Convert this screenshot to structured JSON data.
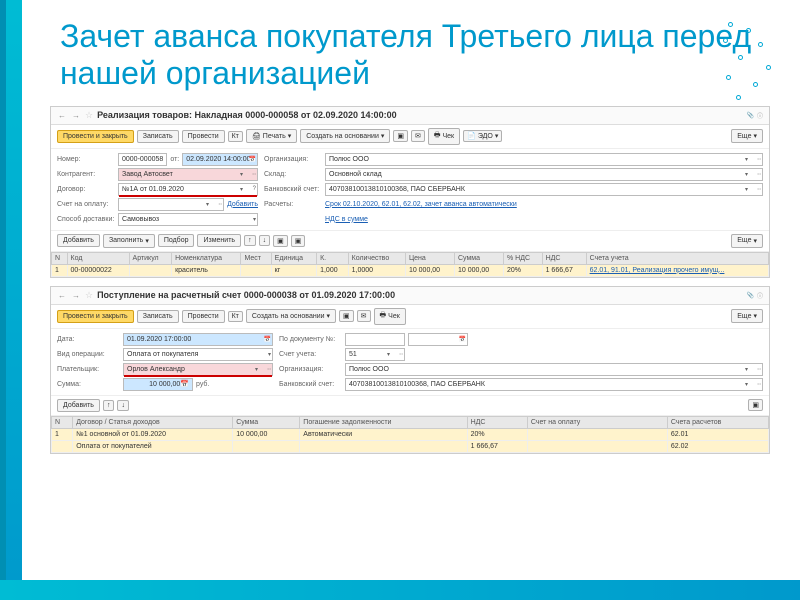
{
  "slide": {
    "title": "Зачет аванса покупателя Третьего лица перед нашей организацией"
  },
  "doc1": {
    "title": "Реализация товаров: Накладная 0000-000058 от 02.09.2020 14:00:00",
    "btn_save_close": "Провести и закрыть",
    "btn_write": "Записать",
    "btn_post": "Провести",
    "btn_print": "Печать",
    "btn_create_based": "Создать на основании",
    "btn_check": "Чек",
    "btn_edo": "ЭДО",
    "btn_more": "Еще",
    "lbl_number": "Номер:",
    "val_number": "0000-000058",
    "lbl_date": "от:",
    "val_date": "02.09.2020 14:00:00",
    "lbl_org": "Организация:",
    "val_org": "Полюс ООО",
    "lbl_contragent": "Контрагент:",
    "val_contragent": "Завод Автосвет",
    "lbl_warehouse": "Склад:",
    "val_warehouse": "Основной склад",
    "lbl_contract": "Договор:",
    "val_contract": "№1А от 01.09.2020",
    "lbl_bank": "Банковский счет:",
    "val_bank": "40703810013810100368, ПАО СБЕРБАНК",
    "lbl_invoice": "Счет на оплату:",
    "lbl_add": "Добавить",
    "lbl_calc": "Расчеты:",
    "val_calc": "Срок 02.10.2020, 62.01, 62.02, зачет аванса автоматически",
    "lbl_delivery": "Способ доставки:",
    "val_delivery": "Самовывоз",
    "lbl_vat": "НДС в сумме",
    "tb_add": "Добавить",
    "tb_fill": "Заполнить",
    "tb_pick": "Подбор",
    "tb_change": "Изменить",
    "cols": {
      "n": "N",
      "code": "Код",
      "art": "Артикул",
      "nom": "Номенклатура",
      "place": "Мест",
      "unit": "Единица",
      "k": "К.",
      "qty": "Количество",
      "price": "Цена",
      "sum": "Сумма",
      "vatp": "% НДС",
      "vat": "НДС",
      "acc": "Счета учета"
    },
    "row": {
      "n": "1",
      "code": "00-00000022",
      "nom": "краситель",
      "unit": "кг",
      "k": "1,000",
      "qty": "1,0000",
      "price": "10 000,00",
      "sum": "10 000,00",
      "vatp": "20%",
      "vat": "1 666,67",
      "acc": "62.01, 91.01, Реализация прочего имущ..."
    }
  },
  "doc2": {
    "title": "Поступление на расчетный счет 0000-000038 от 01.09.2020 17:00:00",
    "btn_save_close": "Провести и закрыть",
    "btn_write": "Записать",
    "btn_post": "Провести",
    "btn_create_based": "Создать на основании",
    "btn_check": "Чек",
    "btn_more": "Еще",
    "lbl_date": "Дата:",
    "val_date": "01.09.2020 17:00:00",
    "lbl_docnum": "По документу №:",
    "lbl_op": "Вид операции:",
    "val_op": "Оплата от покупателя",
    "lbl_acc": "Счет учета:",
    "val_acc": "51",
    "lbl_payer": "Плательщик:",
    "val_payer": "Орлов Александр",
    "lbl_org": "Организация:",
    "val_org": "Полюс ООО",
    "lbl_sum": "Сумма:",
    "val_sum": "10 000,00",
    "val_cur": "руб.",
    "lbl_bank": "Банковский счет:",
    "val_bank": "40703810013810100368, ПАО СБЕРБАНК",
    "tb_add": "Добавить",
    "cols": {
      "n": "N",
      "contract": "Договор / Статья доходов",
      "sum": "Сумма",
      "repay": "Погашение задолженности",
      "vat": "НДС",
      "invoice": "Счет на оплату",
      "accounts": "Счета расчетов"
    },
    "row1": {
      "n": "1",
      "contract": "№1 основной от 01.09.2020",
      "sum": "10 000,00",
      "repay": "Автоматически",
      "vat": "20%",
      "acc": "62.01"
    },
    "row2": {
      "contract": "Оплата от покупателей",
      "vat": "1 666,67",
      "acc": "62.02"
    }
  }
}
